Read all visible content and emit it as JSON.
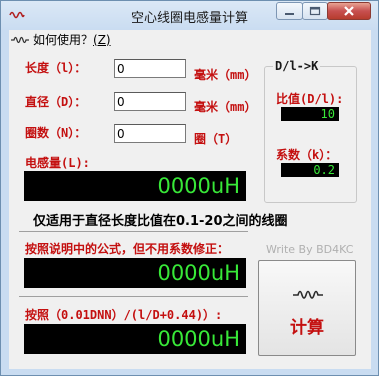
{
  "window": {
    "title": "空心线圈电感量计算"
  },
  "menu": {
    "help_label": "如何使用？",
    "help_shortcut": "(Z)"
  },
  "inputs": {
    "length": {
      "label": "长度（l）：",
      "value": "0",
      "unit": "毫米（mm）"
    },
    "diameter": {
      "label": "直径（D）：",
      "value": "0",
      "unit": "毫米（mm）"
    },
    "turns": {
      "label": "圈数（N）：",
      "value": "0",
      "unit": "圈（T）"
    }
  },
  "ratio_group": {
    "title": "D/l->K",
    "ratio_label": "比值(D/l):",
    "ratio_value": "10",
    "coef_label": "系数（k）：",
    "coef_value": "0.2"
  },
  "inductance": {
    "label": "电感量(L):",
    "value": "0000uH"
  },
  "note": "仅适用于直径长度比值在0.1-20之间的线圈",
  "formula1": {
    "label": "按照说明中的公式，但不用系数修正：",
    "value": "0000uH"
  },
  "formula2": {
    "label": "按照（0.01DNN）/(l/D+0.44)）:",
    "value": "0000uH"
  },
  "author": "Write By BD4KC",
  "calc_button": {
    "label": "计算",
    "icon": "coil-icon"
  },
  "colors": {
    "label_red": "#c41010",
    "lcd_text": "#38e838",
    "lcd_bg": "#000000"
  }
}
